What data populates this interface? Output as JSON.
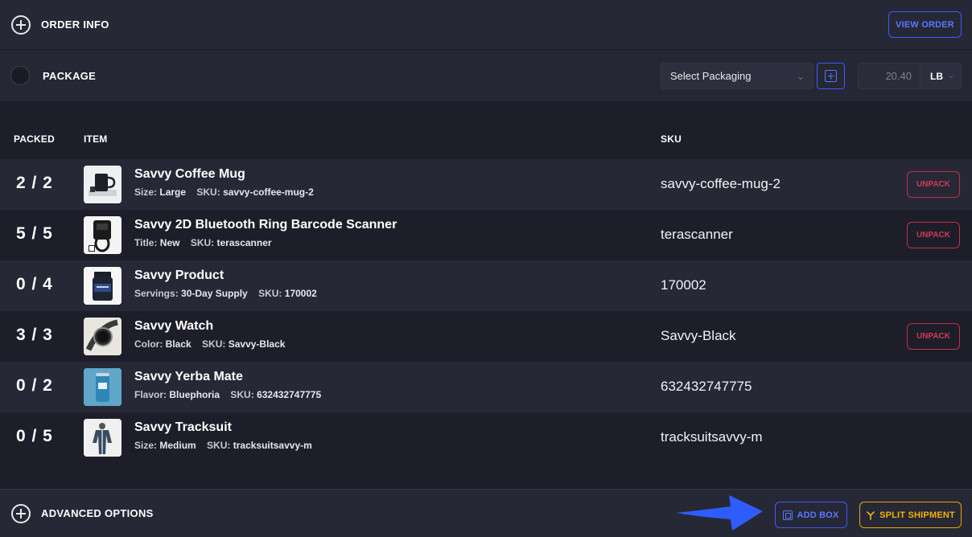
{
  "header": {
    "title": "ORDER INFO",
    "view_order_label": "VIEW ORDER"
  },
  "package": {
    "title": "PACKAGE",
    "select_value": "Select Packaging",
    "weight_value": "20.40",
    "weight_unit": "LB"
  },
  "table": {
    "headers": {
      "packed": "PACKED",
      "item": "ITEM",
      "sku": "SKU"
    },
    "unpack_label": "UNPACK",
    "rows": [
      {
        "packed": "2 / 2",
        "name": "Savvy Coffee Mug",
        "attr_label": "Size:",
        "attr_value": "Large",
        "sku_label": "SKU:",
        "sku_inline": "savvy-coffee-mug-2",
        "sku": "savvy-coffee-mug-2",
        "thumb_icon": "coffee-mug-icon"
      },
      {
        "packed": "5 / 5",
        "name": "Savvy 2D Bluetooth Ring Barcode Scanner",
        "attr_label": "Title:",
        "attr_value": "New",
        "sku_label": "SKU:",
        "sku_inline": "terascanner",
        "sku": "terascanner",
        "thumb_icon": "ring-scanner-icon"
      },
      {
        "packed": "0 / 4",
        "name": "Savvy Product",
        "attr_label": "Servings:",
        "attr_value": "30-Day Supply",
        "sku_label": "SKU:",
        "sku_inline": "170002",
        "sku": "170002",
        "thumb_icon": "supplement-jar-icon"
      },
      {
        "packed": "3 / 3",
        "name": "Savvy Watch",
        "attr_label": "Color:",
        "attr_value": "Black",
        "sku_label": "SKU:",
        "sku_inline": "Savvy-Black",
        "sku": "Savvy-Black",
        "thumb_icon": "watch-icon"
      },
      {
        "packed": "0 / 2",
        "name": "Savvy Yerba Mate",
        "attr_label": "Flavor:",
        "attr_value": "Bluephoria",
        "sku_label": "SKU:",
        "sku_inline": "632432747775",
        "sku": "632432747775",
        "thumb_icon": "can-icon"
      },
      {
        "packed": "0 / 5",
        "name": "Savvy Tracksuit",
        "attr_label": "Size:",
        "attr_value": "Medium",
        "sku_label": "SKU:",
        "sku_inline": "tracksuitsavvy-m",
        "sku": "tracksuitsavvy-m",
        "thumb_icon": "tracksuit-icon"
      }
    ]
  },
  "footer": {
    "title": "ADVANCED OPTIONS",
    "add_box_label": "ADD BOX",
    "split_label": "SPLIT SHIPMENT"
  },
  "colors": {
    "accent_blue": "#3d5bff",
    "unpack_red": "#c1304a",
    "split_yellow": "#e9a400",
    "background": "#1d1e29"
  }
}
